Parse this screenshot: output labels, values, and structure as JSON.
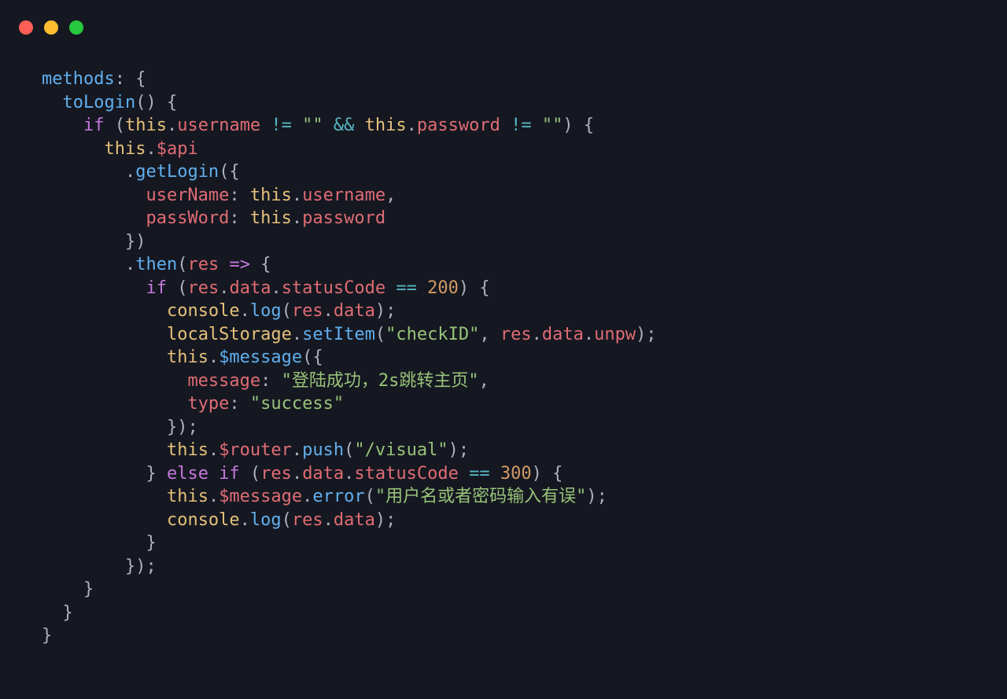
{
  "traffic": {
    "close": "#ff5f56",
    "min": "#ffbd2e",
    "max": "#27c93f"
  },
  "code": {
    "l1_methods": "methods",
    "l1_colon_brace": ": {",
    "l2_toLogin": "toLogin",
    "l2_parens_brace": "() {",
    "l3_if": "if",
    "l3_lp": " (",
    "l3_this1": "this",
    "l3_dot1": ".",
    "l3_username": "username",
    "l3_ne1": " != ",
    "l3_q1": "\"\"",
    "l3_and": " && ",
    "l3_this2": "this",
    "l3_dot2": ".",
    "l3_password": "password",
    "l3_ne2": " != ",
    "l3_q2": "\"\"",
    "l3_rp_brace": ") {",
    "l4_this": "this",
    "l4_dot": ".",
    "l4_api": "$api",
    "l5_dot": ".",
    "l5_getLogin": "getLogin",
    "l5_lp_brace": "({",
    "l6_userName": "userName",
    "l6_colon": ": ",
    "l6_this": "this",
    "l6_dot": ".",
    "l6_username": "username",
    "l6_comma": ",",
    "l7_passWord": "passWord",
    "l7_colon": ": ",
    "l7_this": "this",
    "l7_dot": ".",
    "l7_password": "password",
    "l8_close": "})",
    "l9_dot": ".",
    "l9_then": "then",
    "l9_lp": "(",
    "l9_res": "res",
    "l9_arrow": " => ",
    "l9_brace": "{",
    "l10_if": "if",
    "l10_lp": " (",
    "l10_res": "res",
    "l10_d1": ".",
    "l10_data": "data",
    "l10_d2": ".",
    "l10_statusCode": "statusCode",
    "l10_eq": " == ",
    "l10_200": "200",
    "l10_rp_brace": ") {",
    "l11_console": "console",
    "l11_dot": ".",
    "l11_log": "log",
    "l11_lp": "(",
    "l11_res": "res",
    "l11_d1": ".",
    "l11_data": "data",
    "l11_rp": ");",
    "l12_localStorage": "localStorage",
    "l12_dot": ".",
    "l12_setItem": "setItem",
    "l12_lp": "(",
    "l12_checkID": "\"checkID\"",
    "l12_comma": ", ",
    "l12_res": "res",
    "l12_d1": ".",
    "l12_data": "data",
    "l12_d2": ".",
    "l12_unpw": "unpw",
    "l12_rp": ");",
    "l13_this": "this",
    "l13_dot": ".",
    "l13_message": "$message",
    "l13_lp_brace": "({",
    "l14_message": "message",
    "l14_colon": ": ",
    "l14_str": "\"登陆成功，2s跳转主页\"",
    "l14_comma": ",",
    "l15_type": "type",
    "l15_colon": ": ",
    "l15_success": "\"success\"",
    "l16_close": "});",
    "l17_this": "this",
    "l17_dot": ".",
    "l17_router": "$router",
    "l17_d2": ".",
    "l17_push": "push",
    "l17_lp": "(",
    "l17_visual": "\"/visual\"",
    "l17_rp": ");",
    "l18_rbrace": "} ",
    "l18_else": "else",
    "l18_sp": " ",
    "l18_if": "if",
    "l18_lp": " (",
    "l18_res": "res",
    "l18_d1": ".",
    "l18_data": "data",
    "l18_d2": ".",
    "l18_statusCode": "statusCode",
    "l18_eq": " == ",
    "l18_300": "300",
    "l18_rp_brace": ") {",
    "l19_this": "this",
    "l19_d1": ".",
    "l19_message": "$message",
    "l19_d2": ".",
    "l19_error": "error",
    "l19_lp": "(",
    "l19_str": "\"用户名或者密码输入有误\"",
    "l19_rp": ");",
    "l20_console": "console",
    "l20_dot": ".",
    "l20_log": "log",
    "l20_lp": "(",
    "l20_res": "res",
    "l20_d1": ".",
    "l20_data": "data",
    "l20_rp": ");",
    "l21_rbrace": "}",
    "l22_close": "});",
    "l23_rbrace": "}",
    "l24_rbrace": "}",
    "l25_rbrace": "}"
  }
}
